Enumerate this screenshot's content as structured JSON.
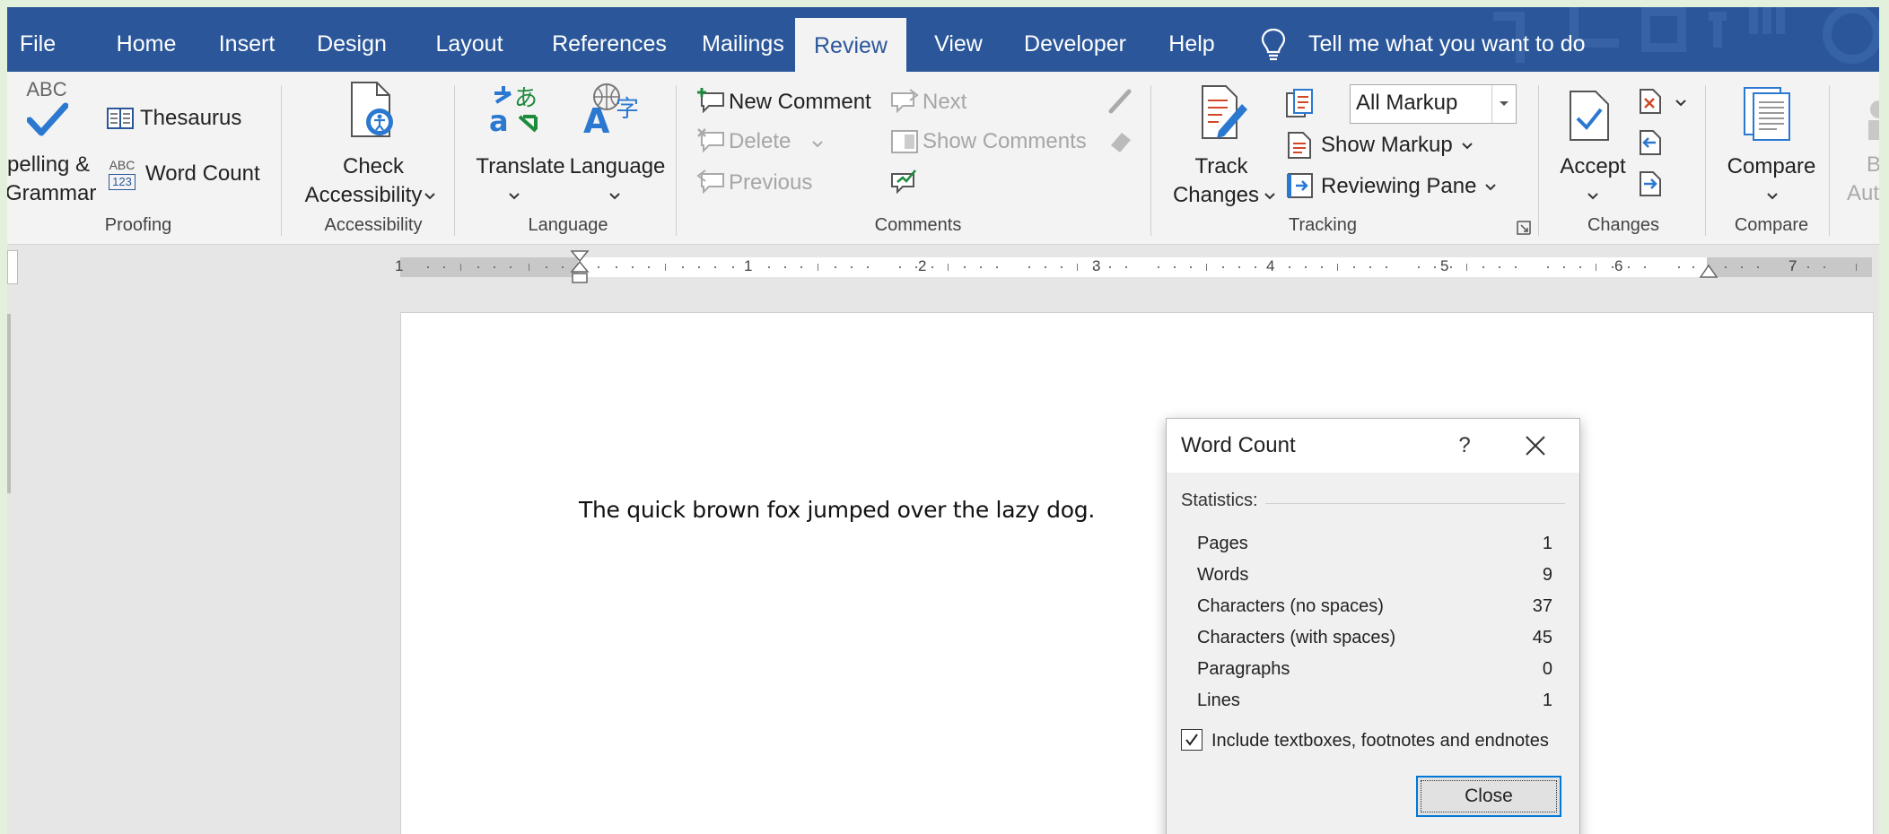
{
  "menu": {
    "tabs": [
      "File",
      "Home",
      "Insert",
      "Design",
      "Layout",
      "References",
      "Mailings",
      "Review",
      "View",
      "Developer",
      "Help"
    ],
    "active_tab": "Review",
    "tell_me": "Tell me what you want to do"
  },
  "ribbon": {
    "proofing": {
      "abc_caption": "ABC",
      "spelling_line1": "pelling &",
      "spelling_line2": "Grammar",
      "thesaurus": "Thesaurus",
      "wordcount_icon_top": "ABC",
      "wordcount_icon_bottom": "123",
      "word_count": "Word Count",
      "group_label": "Proofing"
    },
    "accessibility": {
      "line1": "Check",
      "line2": "Accessibility",
      "group_label": "Accessibility"
    },
    "language": {
      "translate": "Translate",
      "language": "Language",
      "group_label": "Language"
    },
    "comments": {
      "new_comment": "New Comment",
      "delete": "Delete",
      "previous": "Previous",
      "next": "Next",
      "show_comments": "Show Comments",
      "group_label": "Comments"
    },
    "tracking": {
      "line1": "Track",
      "line2": "Changes",
      "markup_select": "All Markup",
      "show_markup": "Show Markup",
      "reviewing_pane": "Reviewing Pane",
      "group_label": "Tracking"
    },
    "changes": {
      "accept": "Accept",
      "group_label": "Changes"
    },
    "compare": {
      "compare": "Compare",
      "group_label": "Compare"
    },
    "partial": {
      "line1": "B",
      "line2": "Aut"
    }
  },
  "ruler": {
    "numbers": [
      "1",
      "1",
      "2",
      "3",
      "4",
      "5",
      "6",
      "7"
    ]
  },
  "document": {
    "text": "The quick brown fox jumped over the lazy dog."
  },
  "dialog": {
    "title": "Word Count",
    "help": "?",
    "section": "Statistics:",
    "stats": [
      {
        "label": "Pages",
        "value": "1"
      },
      {
        "label": "Words",
        "value": "9"
      },
      {
        "label": "Characters (no spaces)",
        "value": "37"
      },
      {
        "label": "Characters (with spaces)",
        "value": "45"
      },
      {
        "label": "Paragraphs",
        "value": "0"
      },
      {
        "label": "Lines",
        "value": "1"
      }
    ],
    "checkbox_label": "Include textboxes, footnotes and endnotes",
    "checkbox_checked": true,
    "close_button": "Close"
  },
  "colors": {
    "ribbon_blue": "#2b579a",
    "outer_background": "#e3f0dc",
    "accent_focus": "#0078d7"
  }
}
